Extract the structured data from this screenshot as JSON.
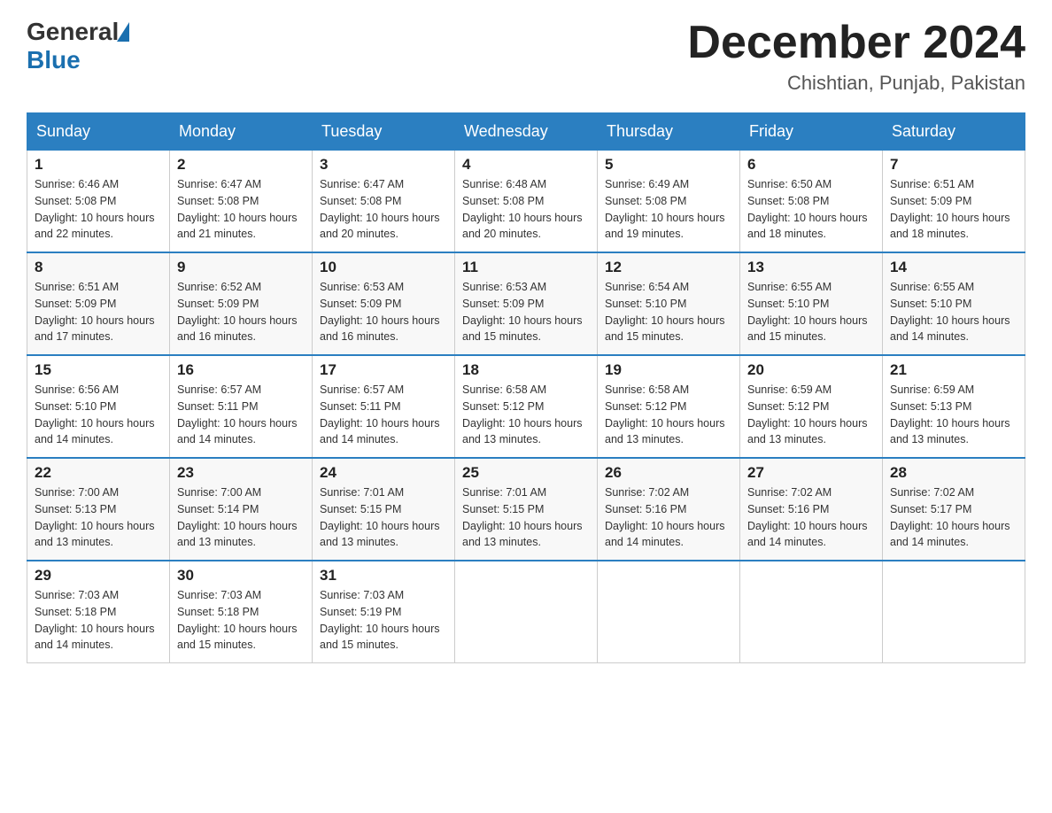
{
  "header": {
    "logo_general": "General",
    "logo_blue": "Blue",
    "title": "December 2024",
    "subtitle": "Chishtian, Punjab, Pakistan"
  },
  "days_of_week": [
    "Sunday",
    "Monday",
    "Tuesday",
    "Wednesday",
    "Thursday",
    "Friday",
    "Saturday"
  ],
  "weeks": [
    [
      {
        "day": "1",
        "sunrise": "6:46 AM",
        "sunset": "5:08 PM",
        "daylight": "10 hours and 22 minutes."
      },
      {
        "day": "2",
        "sunrise": "6:47 AM",
        "sunset": "5:08 PM",
        "daylight": "10 hours and 21 minutes."
      },
      {
        "day": "3",
        "sunrise": "6:47 AM",
        "sunset": "5:08 PM",
        "daylight": "10 hours and 20 minutes."
      },
      {
        "day": "4",
        "sunrise": "6:48 AM",
        "sunset": "5:08 PM",
        "daylight": "10 hours and 20 minutes."
      },
      {
        "day": "5",
        "sunrise": "6:49 AM",
        "sunset": "5:08 PM",
        "daylight": "10 hours and 19 minutes."
      },
      {
        "day": "6",
        "sunrise": "6:50 AM",
        "sunset": "5:08 PM",
        "daylight": "10 hours and 18 minutes."
      },
      {
        "day": "7",
        "sunrise": "6:51 AM",
        "sunset": "5:09 PM",
        "daylight": "10 hours and 18 minutes."
      }
    ],
    [
      {
        "day": "8",
        "sunrise": "6:51 AM",
        "sunset": "5:09 PM",
        "daylight": "10 hours and 17 minutes."
      },
      {
        "day": "9",
        "sunrise": "6:52 AM",
        "sunset": "5:09 PM",
        "daylight": "10 hours and 16 minutes."
      },
      {
        "day": "10",
        "sunrise": "6:53 AM",
        "sunset": "5:09 PM",
        "daylight": "10 hours and 16 minutes."
      },
      {
        "day": "11",
        "sunrise": "6:53 AM",
        "sunset": "5:09 PM",
        "daylight": "10 hours and 15 minutes."
      },
      {
        "day": "12",
        "sunrise": "6:54 AM",
        "sunset": "5:10 PM",
        "daylight": "10 hours and 15 minutes."
      },
      {
        "day": "13",
        "sunrise": "6:55 AM",
        "sunset": "5:10 PM",
        "daylight": "10 hours and 15 minutes."
      },
      {
        "day": "14",
        "sunrise": "6:55 AM",
        "sunset": "5:10 PM",
        "daylight": "10 hours and 14 minutes."
      }
    ],
    [
      {
        "day": "15",
        "sunrise": "6:56 AM",
        "sunset": "5:10 PM",
        "daylight": "10 hours and 14 minutes."
      },
      {
        "day": "16",
        "sunrise": "6:57 AM",
        "sunset": "5:11 PM",
        "daylight": "10 hours and 14 minutes."
      },
      {
        "day": "17",
        "sunrise": "6:57 AM",
        "sunset": "5:11 PM",
        "daylight": "10 hours and 14 minutes."
      },
      {
        "day": "18",
        "sunrise": "6:58 AM",
        "sunset": "5:12 PM",
        "daylight": "10 hours and 13 minutes."
      },
      {
        "day": "19",
        "sunrise": "6:58 AM",
        "sunset": "5:12 PM",
        "daylight": "10 hours and 13 minutes."
      },
      {
        "day": "20",
        "sunrise": "6:59 AM",
        "sunset": "5:12 PM",
        "daylight": "10 hours and 13 minutes."
      },
      {
        "day": "21",
        "sunrise": "6:59 AM",
        "sunset": "5:13 PM",
        "daylight": "10 hours and 13 minutes."
      }
    ],
    [
      {
        "day": "22",
        "sunrise": "7:00 AM",
        "sunset": "5:13 PM",
        "daylight": "10 hours and 13 minutes."
      },
      {
        "day": "23",
        "sunrise": "7:00 AM",
        "sunset": "5:14 PM",
        "daylight": "10 hours and 13 minutes."
      },
      {
        "day": "24",
        "sunrise": "7:01 AM",
        "sunset": "5:15 PM",
        "daylight": "10 hours and 13 minutes."
      },
      {
        "day": "25",
        "sunrise": "7:01 AM",
        "sunset": "5:15 PM",
        "daylight": "10 hours and 13 minutes."
      },
      {
        "day": "26",
        "sunrise": "7:02 AM",
        "sunset": "5:16 PM",
        "daylight": "10 hours and 14 minutes."
      },
      {
        "day": "27",
        "sunrise": "7:02 AM",
        "sunset": "5:16 PM",
        "daylight": "10 hours and 14 minutes."
      },
      {
        "day": "28",
        "sunrise": "7:02 AM",
        "sunset": "5:17 PM",
        "daylight": "10 hours and 14 minutes."
      }
    ],
    [
      {
        "day": "29",
        "sunrise": "7:03 AM",
        "sunset": "5:18 PM",
        "daylight": "10 hours and 14 minutes."
      },
      {
        "day": "30",
        "sunrise": "7:03 AM",
        "sunset": "5:18 PM",
        "daylight": "10 hours and 15 minutes."
      },
      {
        "day": "31",
        "sunrise": "7:03 AM",
        "sunset": "5:19 PM",
        "daylight": "10 hours and 15 minutes."
      },
      null,
      null,
      null,
      null
    ]
  ],
  "labels": {
    "sunrise": "Sunrise:",
    "sunset": "Sunset:",
    "daylight": "Daylight:"
  }
}
